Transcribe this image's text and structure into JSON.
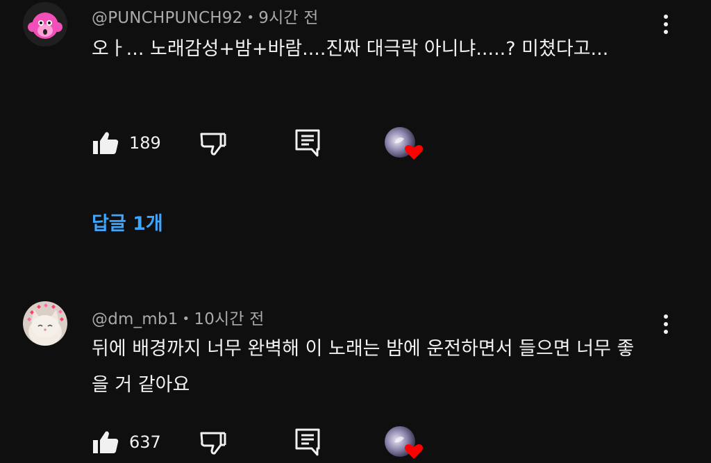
{
  "comments": [
    {
      "author": "@PUNCHPUNCH92",
      "separator": "•",
      "time": "9시간 전",
      "text": "오ㅏ... 노래감성+밤+바람....진짜 대극락 아니냐.....? 미쳤다고...",
      "like_count": "189",
      "avatar_icon": "pink-monkey-avatar",
      "replies_label": "답글 1개"
    },
    {
      "author": "@dm_mb1",
      "separator": "•",
      "time": "10시간 전",
      "text": "뒤에 배경까지 너무 완벽해 이 노래는 밤에 운전하면서 들으면 너무 좋을 거 같아요",
      "like_count": "637",
      "avatar_icon": "cat-with-hearts-avatar"
    }
  ],
  "colors": {
    "background": "#0f0f0f",
    "text_primary": "#f1f1f1",
    "text_secondary": "#aaaaaa",
    "link_blue": "#3ea6ff",
    "heart_red": "#ff0000"
  }
}
